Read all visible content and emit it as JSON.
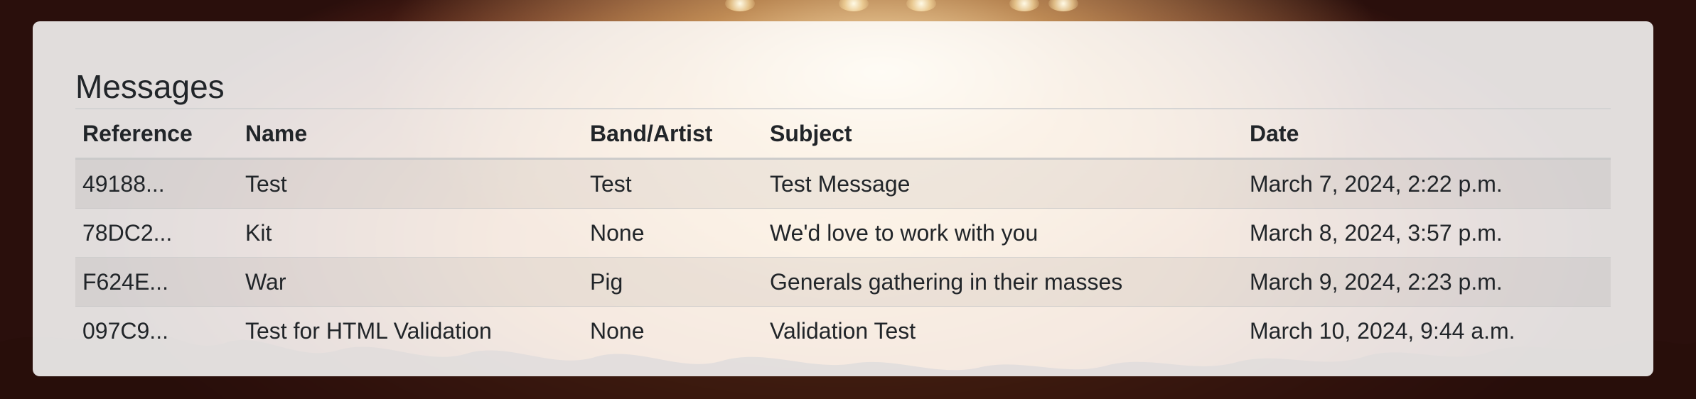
{
  "page": {
    "title": "Messages"
  },
  "table": {
    "headers": {
      "reference": "Reference",
      "name": "Name",
      "band": "Band/Artist",
      "subject": "Subject",
      "date": "Date"
    },
    "rows": [
      {
        "reference": "49188...",
        "name": "Test",
        "band": "Test",
        "subject": "Test Message",
        "date": "March 7, 2024, 2:22 p.m."
      },
      {
        "reference": "78DC2...",
        "name": "Kit",
        "band": "None",
        "subject": "We'd love to work with you",
        "date": "March 8, 2024, 3:57 p.m."
      },
      {
        "reference": "F624E...",
        "name": "War",
        "band": "Pig",
        "subject": "Generals gathering in their masses",
        "date": "March 9, 2024, 2:23 p.m."
      },
      {
        "reference": "097C9...",
        "name": "Test for HTML Validation",
        "band": "None",
        "subject": "Validation Test",
        "date": "March 10, 2024, 9:44 a.m."
      }
    ]
  },
  "colors": {
    "text": "#212529",
    "panel": "#ffffff",
    "background_accent": "#e09a45"
  }
}
